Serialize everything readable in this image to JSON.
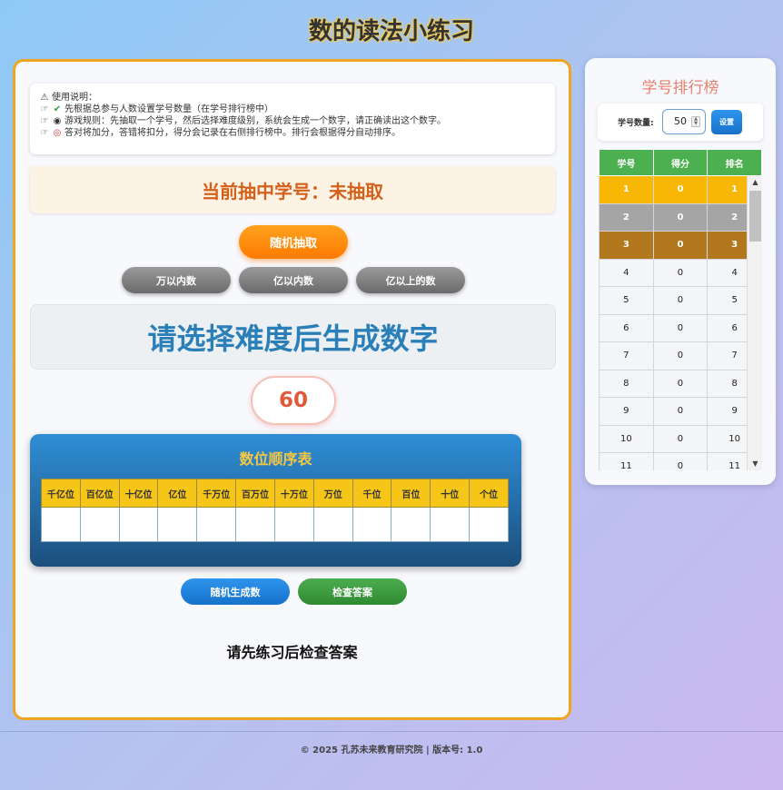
{
  "title": "数的读法小练习",
  "instructions": {
    "heading": "使用说明：",
    "lines": [
      "先根据总参与人数设置学号数量（在学号排行榜中）",
      "游戏规则：先抽取一个学号，然后选择难度级别，系统会生成一个数字，请正确读出这个数字。",
      "答对将加分，答错将扣分，得分会记录在右侧排行榜中。排行会根据得分自动排序。"
    ],
    "icons": [
      "warning-icon",
      "pointing-hand-icon",
      "check-mark-icon",
      "gamepad-icon",
      "target-icon"
    ]
  },
  "current": {
    "label": "当前抽中学号：",
    "value": "未抽取"
  },
  "buttons": {
    "draw": "随机抽取",
    "level_1": "万以内数",
    "level_2": "亿以内数",
    "level_3": "亿以上的数",
    "generate": "随机生成数",
    "check": "检查答案"
  },
  "display_text": "请选择难度后生成数字",
  "timer": "60",
  "digit_table": {
    "title": "数位顺序表",
    "headers": [
      "千亿位",
      "百亿位",
      "十亿位",
      "亿位",
      "千万位",
      "百万位",
      "十万位",
      "万位",
      "千位",
      "百位",
      "十位",
      "个位"
    ]
  },
  "result_text": "请先练习后检查答案",
  "ranking": {
    "title": "学号排行榜",
    "count_label": "学号数量:",
    "count_value": "50",
    "set_button": "设置",
    "headers": [
      "学号",
      "得分",
      "排名"
    ],
    "rows": [
      [
        "1",
        "0",
        "1"
      ],
      [
        "2",
        "0",
        "2"
      ],
      [
        "3",
        "0",
        "3"
      ],
      [
        "4",
        "0",
        "4"
      ],
      [
        "5",
        "0",
        "5"
      ],
      [
        "6",
        "0",
        "6"
      ],
      [
        "7",
        "0",
        "7"
      ],
      [
        "8",
        "0",
        "8"
      ],
      [
        "9",
        "0",
        "9"
      ],
      [
        "10",
        "0",
        "10"
      ],
      [
        "11",
        "0",
        "11"
      ]
    ]
  },
  "footer": "© 2025 孔苏未来教育研究院 | 版本号: 1.0",
  "colors": {
    "accent_orange": "#ff8a00",
    "border_orange": "#f0a520",
    "rank_header_green": "#4caf50",
    "gold": "#f8b704",
    "silver": "#a5a5a5",
    "bronze": "#b2781e"
  }
}
